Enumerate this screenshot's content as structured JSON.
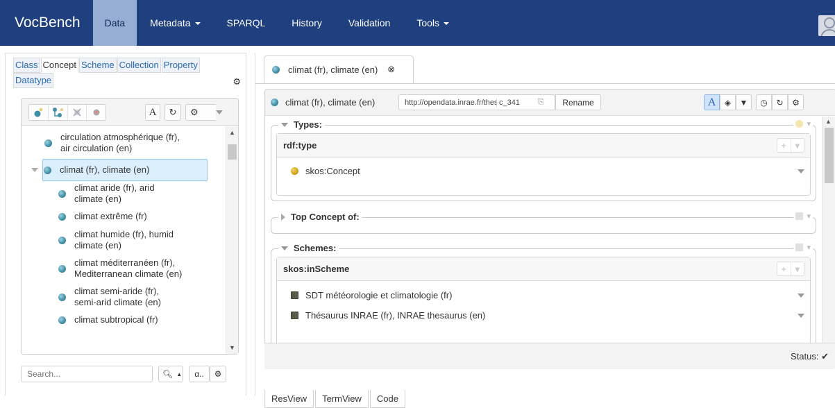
{
  "navbar": {
    "brand": "VocBench",
    "items": [
      {
        "label": "Data",
        "active": true
      },
      {
        "label": "Metadata",
        "dropdown": true
      },
      {
        "label": "SPARQL"
      },
      {
        "label": "History"
      },
      {
        "label": "Validation"
      },
      {
        "label": "Tools",
        "dropdown": true
      }
    ]
  },
  "left": {
    "tabs": [
      "Class",
      "Concept",
      "Scheme",
      "Collection",
      "Property",
      "Datatype"
    ],
    "active_tab": "Concept",
    "tree": {
      "toolbar_lang": "A",
      "items": [
        {
          "line1": "circulation atmosphérique (fr),",
          "line2": "air circulation (en)"
        },
        {
          "line1": "climat (fr), climate (en)",
          "selected": true,
          "expanded": true
        },
        {
          "line1": "climat aride (fr), arid",
          "line2": "climate (en)"
        },
        {
          "line1": "climat extrême (fr)"
        },
        {
          "line1": "climat humide (fr), humid",
          "line2": "climate (en)"
        },
        {
          "line1": "climat méditerranéen (fr),",
          "line2": "Mediterranean climate (en)"
        },
        {
          "line1": "climat semi-aride (fr),",
          "line2": "semi-arid climate (en)"
        },
        {
          "line1": "climat subtropical (fr)"
        }
      ]
    },
    "search": {
      "placeholder": "Search...",
      "alpha_label": "α.."
    }
  },
  "right": {
    "tab_label": "climat (fr), climate (en)",
    "header": {
      "title": "climat (fr), climate (en)",
      "namespace": "http://opendata.inrae.fr/thesaurusINRAE/",
      "localname": "c_341",
      "rename_label": "Rename",
      "lang_toggle": "A"
    },
    "sections": {
      "types": {
        "title": "Types:",
        "property": "rdf:type",
        "values": [
          "skos:Concept"
        ]
      },
      "top_concept": {
        "title": "Top Concept of:"
      },
      "schemes": {
        "title": "Schemes:",
        "property": "skos:inScheme",
        "values": [
          "SDT météorologie et climatologie (fr)",
          "Thésaurus INRAE (fr), INRAE thesaurus (en)"
        ]
      }
    },
    "status_label": "Status:",
    "view_tabs": [
      "ResView",
      "TermView",
      "Code"
    ],
    "active_view": "ResView"
  },
  "colors": {
    "navbar": "#1f3f7e",
    "active_nav": "#96aed4",
    "link": "#2a6ab2",
    "selected": "#dbeefb"
  }
}
